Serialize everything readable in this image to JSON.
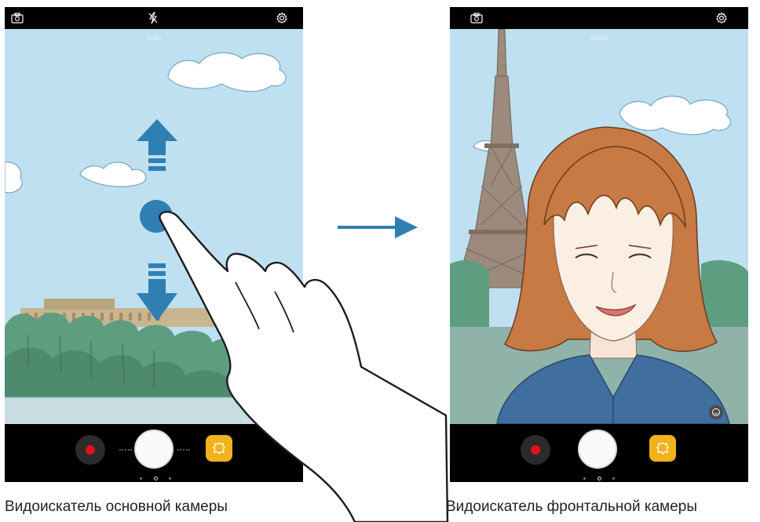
{
  "left_screen": {
    "mode_label": "Auto",
    "top_icons": [
      "switch-camera-icon",
      "flash-off-icon",
      "settings-gear-icon"
    ],
    "bottom_controls": [
      "record-video-button",
      "shutter-button",
      "effects-button"
    ],
    "caption": "Видоискатель основной камеры"
  },
  "right_screen": {
    "mode_label": "Selfie",
    "top_icons": [
      "switch-camera-icon",
      "settings-gear-icon"
    ],
    "bottom_controls": [
      "record-video-button",
      "shutter-button",
      "effects-button",
      "beauty-face-icon"
    ],
    "caption": "Видоискатель фронтальной камеры"
  },
  "gesture": {
    "description_icons": [
      "swipe-up-arrow-icon",
      "touch-point-icon",
      "swipe-down-arrow-icon",
      "hand-pointer-icon",
      "transition-arrow-icon"
    ]
  },
  "colors": {
    "sky": "#bfe0f0",
    "accent_blue": "#2f7fb3",
    "record_red": "#e3101a",
    "effects_yellow": "#f2b21b"
  }
}
